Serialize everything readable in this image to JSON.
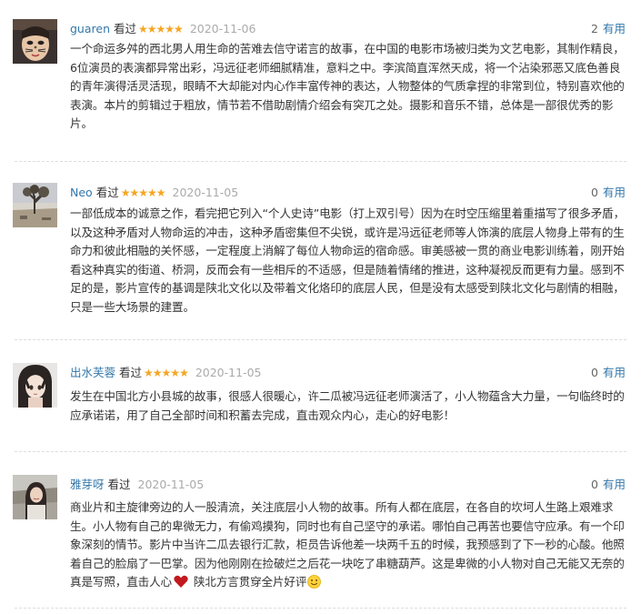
{
  "reviews": [
    {
      "author": "guaren",
      "seen_label": "看过",
      "stars": "★★★★★",
      "date": "2020-11-06",
      "useful_count": "2",
      "useful_label": "有用",
      "avatar_icon": "avatar-cat-face",
      "content": "一个命运多舛的西北男人用生命的苦难去信守诺言的故事，在中国的电影市场被归类为文艺电影，其制作精良，6位演员的表演都异常出彩，冯远征老师细腻精准，意料之中。李滨简直浑然天成，将一个沾染邪恶又底色善良的青年演得活灵活现，眼睛不大却能对内心作丰富传神的表达，人物整体的气质拿捏的非常到位，特别喜欢他的表演。本片的剪辑过于粗放，情节若不借助剧情介绍会有突兀之处。摄影和音乐不错，总体是一部很优秀的影片。"
    },
    {
      "author": "Neo",
      "seen_label": "看过",
      "stars": "★★★★★",
      "date": "2020-11-05",
      "useful_count": "0",
      "useful_label": "有用",
      "avatar_icon": "avatar-tree-landscape",
      "content": "一部低成本的诚意之作，看完把它列入“个人史诗”电影（打上双引号）因为在时空压缩里着重描写了很多矛盾，以及这种矛盾对人物命运的冲击，这种矛盾密集但不尖锐，或许是冯远征老师等人饰演的底层人物身上带有的生命力和彼此相融的关怀感，一定程度上消解了每位人物命运的宿命感。审美感被一贯的商业电影训练着，刚开始看这种真实的街道、桥洞，反而会有一些相斥的不适感，但是随着情绪的推进，这种凝视反而更有力量。感到不足的是，影片宣传的基调是陕北文化以及带着文化烙印的底层人民，但是没有太感受到陕北文化与剧情的相融，只是一些大场景的建置。"
    },
    {
      "author": "出水芙蓉",
      "seen_label": "看过",
      "stars": "★★★★★",
      "date": "2020-11-05",
      "useful_count": "0",
      "useful_label": "有用",
      "avatar_icon": "avatar-anime-girl",
      "content": "发生在中国北方小县城的故事，很感人很暖心，许二瓜被冯远征老师演活了，小人物蕴含大力量，一句临终时的应承诺诺，用了自己全部时间和积蓄去完成，直击观众内心，走心的好电影！"
    },
    {
      "author": "雅芽呀",
      "seen_label": "看过",
      "stars": "",
      "date": "2020-11-05",
      "useful_count": "0",
      "useful_label": "有用",
      "avatar_icon": "avatar-woman-outdoor",
      "content_before_heart": "商业片和主旋律旁边的人一股清流，关注底层小人物的故事。所有人都在底层，在各自的坎坷人生路上艰难求生。小人物有自己的卑微无力，有偷鸡摸狗，同时也有自己坚守的承诺。哪怕自己再苦也要信守应承。有一个印象深刻的情节。影片中当许二瓜去银行汇款，柜员告诉他差一块两千五的时候，我预感到了下一秒的心酸。他照着自己的脸扇了一巴掌。因为他刚刚在捡破烂之后花一块吃了串糖葫芦。这是卑微的小人物对自己无能又无奈的真是写照，直击人心",
      "heart_icon": "heart-icon",
      "content_after_heart": " 陕北方言贯穿全片好评",
      "smile_icon": "smile-emoji-icon"
    }
  ],
  "colors": {
    "author_link": "#3377aa",
    "star": "#f5a623",
    "date": "#aaaaaa",
    "divider": "#dddddd"
  }
}
